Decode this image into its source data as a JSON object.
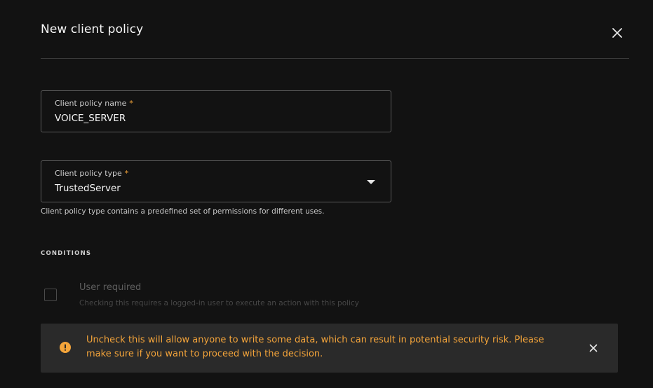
{
  "dialog": {
    "title": "New client policy",
    "close_icon": "close-icon"
  },
  "fields": {
    "name": {
      "label": "Client policy name",
      "required_marker": "*",
      "value": "VOICE_SERVER"
    },
    "type": {
      "label": "Client policy type",
      "required_marker": "*",
      "value": "TrustedServer",
      "helper": "Client policy type contains a predefined set of permissions for different uses."
    }
  },
  "conditions": {
    "section_label": "CONDITIONS",
    "user_required": {
      "title": "User required",
      "description": "Checking this requires a logged-in user to execute an action with this policy",
      "checked": false,
      "disabled": true
    }
  },
  "warning": {
    "icon": "warning-icon",
    "text": "Uncheck this will allow anyone to write some data, which can result in potential security risk. Please make sure if you want to proceed with the decision.",
    "close_icon": "close-icon"
  },
  "colors": {
    "background": "#121212",
    "accent_warning": "#f4a43a",
    "warning_bg": "#2a2a2a",
    "border": "#5a5a5a"
  }
}
